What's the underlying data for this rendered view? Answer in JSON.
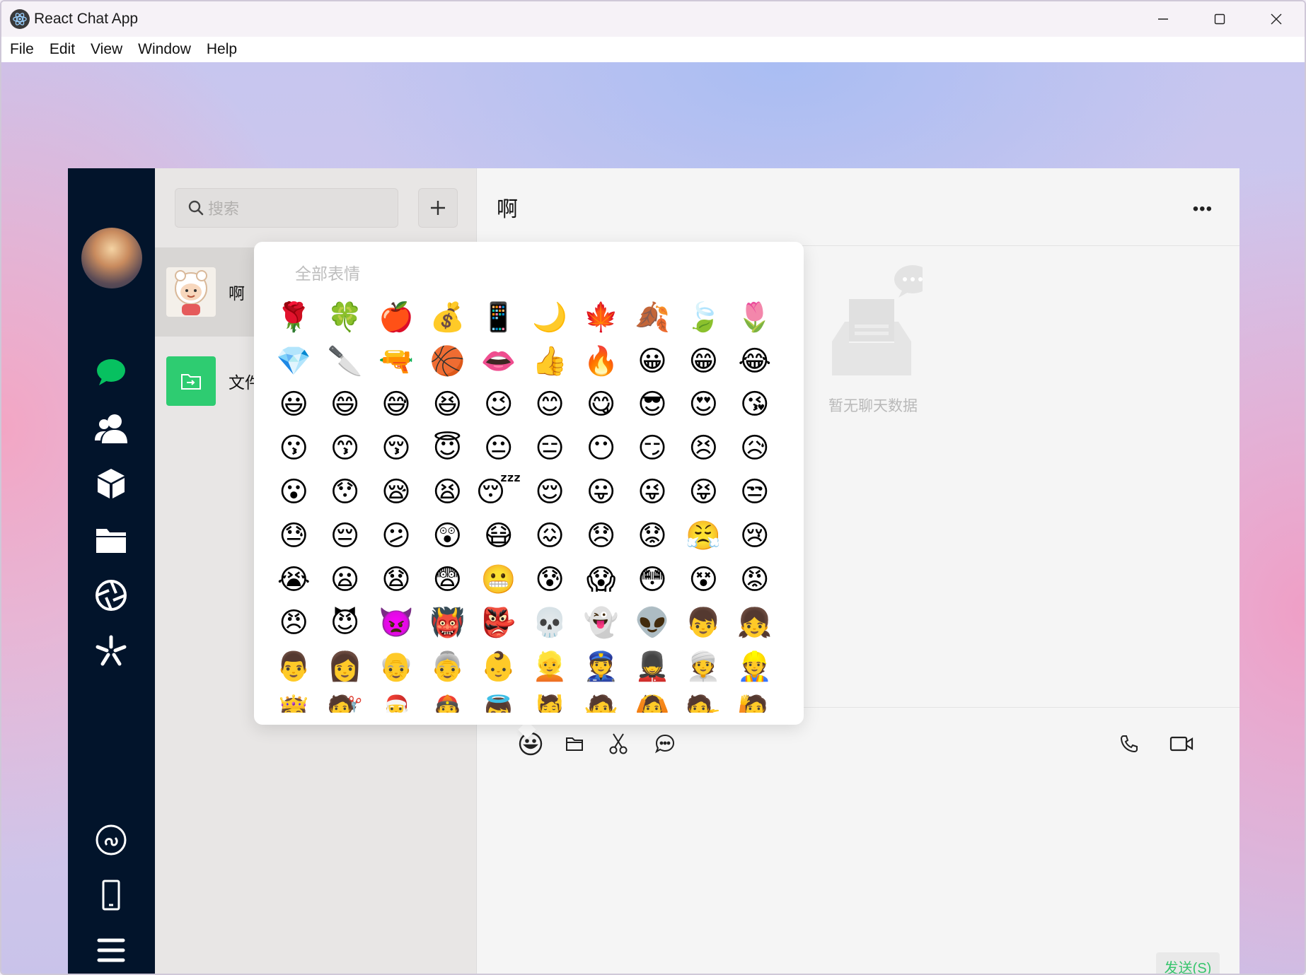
{
  "window": {
    "title": "React Chat App",
    "menu": [
      "File",
      "Edit",
      "View",
      "Window",
      "Help"
    ]
  },
  "sidebar": {
    "nav_icons": [
      "chat-bubble-icon",
      "contacts-icon",
      "cube-icon",
      "folder-icon",
      "aperture-icon",
      "sparkle-icon"
    ],
    "bottom_icons": [
      "link-icon",
      "phone-device-icon",
      "menu-icon"
    ]
  },
  "search": {
    "placeholder": "搜索"
  },
  "conversations": [
    {
      "name": "啊"
    },
    {
      "name": "文件"
    }
  ],
  "chat": {
    "title": "啊",
    "empty_text": "暂无聊天数据",
    "send_label": "发送(S)"
  },
  "emoji_panel": {
    "title": "全部表情",
    "emojis": [
      "🌹",
      "🍀",
      "🍎",
      "💰",
      "📱",
      "🌙",
      "🍁",
      "🍂",
      "🍃",
      "🌷",
      "💎",
      "🔪",
      "🔫",
      "🏀",
      "👄",
      "👍",
      "🔥",
      "😀",
      "😁",
      "😂",
      "😃",
      "😄",
      "😅",
      "😆",
      "😉",
      "😊",
      "😋",
      "😎",
      "😍",
      "😘",
      "😗",
      "😙",
      "😚",
      "😇",
      "😐",
      "😑",
      "😶",
      "😏",
      "😣",
      "😥",
      "😮",
      "😯",
      "😪",
      "😫",
      "😴",
      "😌",
      "😛",
      "😜",
      "😝",
      "😒",
      "😓",
      "😔",
      "😕",
      "😲",
      "😷",
      "😖",
      "😞",
      "😟",
      "😤",
      "😢",
      "😭",
      "😦",
      "😧",
      "😨",
      "😬",
      "😰",
      "😱",
      "😳",
      "😵",
      "😡",
      "😠",
      "😈",
      "👿",
      "👹",
      "👺",
      "💀",
      "👻",
      "👽",
      "👦",
      "👧",
      "👨",
      "👩",
      "👴",
      "👵",
      "👶",
      "👱",
      "👮",
      "💂",
      "👳",
      "👷",
      "👸",
      "💇",
      "🎅",
      "👲",
      "👼",
      "💆",
      "🙅",
      "🙆",
      "💁",
      "🙋"
    ]
  },
  "colors": {
    "nav_bg": "#02142b",
    "accent_green": "#07c160",
    "send_text": "#36c46c"
  }
}
